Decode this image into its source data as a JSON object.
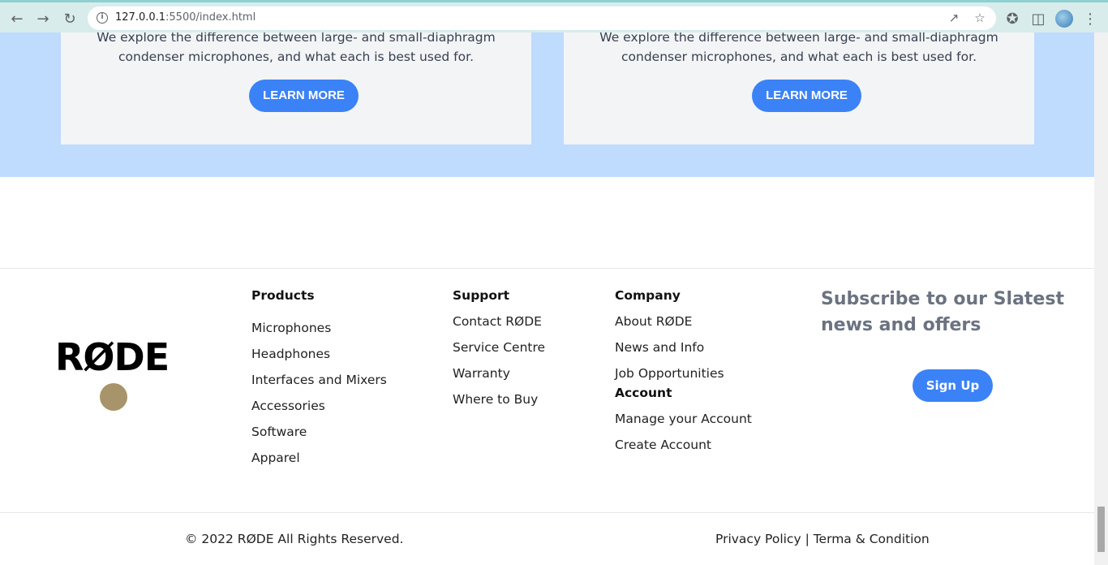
{
  "browser": {
    "url_host": "127.0.0.1",
    "url_path": ":5500/index.html"
  },
  "cards": [
    {
      "description": "We explore the difference between large- and small-diaphragm condenser microphones, and what each is best used for.",
      "button_label": "LEARN MORE"
    },
    {
      "description": "We explore the difference between large- and small-diaphragm condenser microphones, and what each is best used for.",
      "button_label": "LEARN MORE"
    }
  ],
  "footer": {
    "logo_text": "RØDE",
    "products": {
      "heading": "Products",
      "links": [
        "Microphones",
        "Headphones",
        "Interfaces and Mixers",
        "Accessories",
        "Software",
        "Apparel"
      ]
    },
    "support": {
      "heading": "Support",
      "links": [
        "Contact RØDE",
        "Service Centre",
        "Warranty",
        "Where to Buy"
      ]
    },
    "company": {
      "heading": "Company",
      "links": [
        "About RØDE",
        "News and Info",
        "Job Opportunities"
      ]
    },
    "account": {
      "heading": "Account",
      "links": [
        "Manage your Account",
        "Create Account"
      ]
    },
    "subscribe_text": "Subscribe to our Slatest news and offers",
    "signup_label": "Sign Up",
    "copyright": "© 2022 RØDE All Rights Reserved.",
    "privacy_label": "Privacy Policy",
    "separator": " | ",
    "terms_label": "Terma & Condition"
  },
  "colors": {
    "accent": "#3b82f6",
    "band": "#bfdbfe",
    "card": "#f3f4f6",
    "logo_dot": "#a8946a"
  }
}
